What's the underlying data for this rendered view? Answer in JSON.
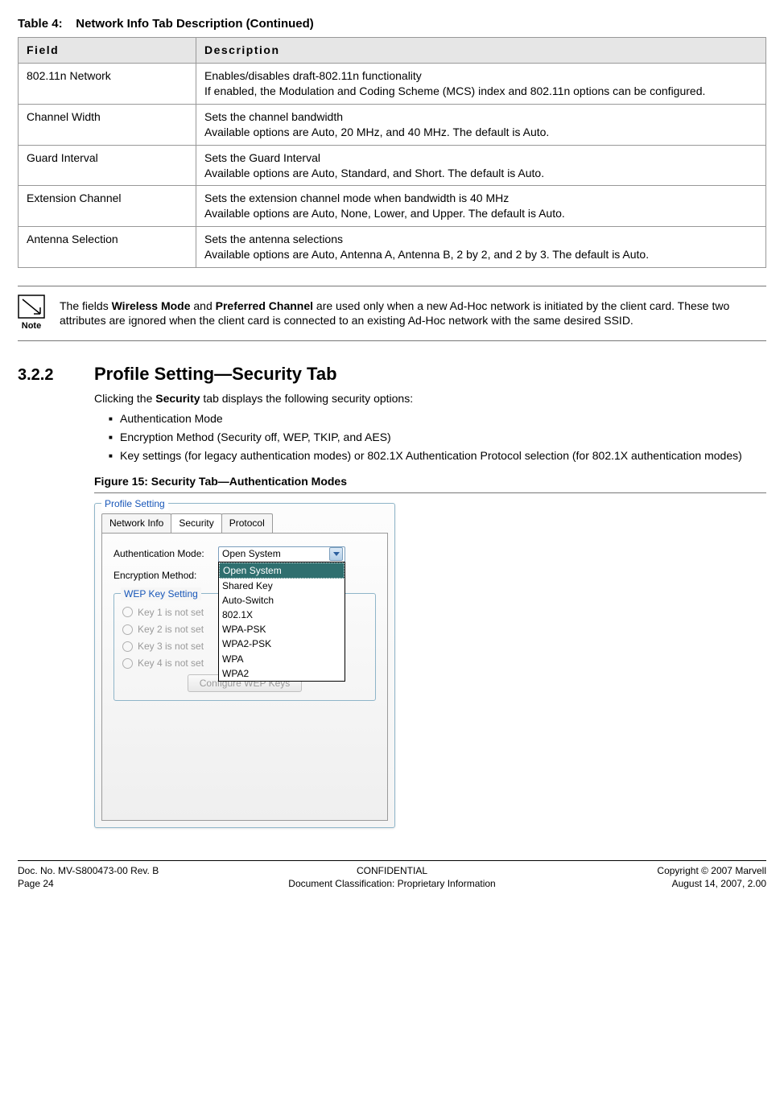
{
  "table": {
    "caption_label": "Table 4:",
    "caption_title": "Network Info Tab Description (Continued)",
    "header_field": "Field",
    "header_desc": "Description",
    "rows": [
      {
        "field": "802.11n Network",
        "desc": "Enables/disables draft-802.11n functionality\nIf enabled, the Modulation and Coding Scheme (MCS) index and 802.11n options can be configured."
      },
      {
        "field": "Channel Width",
        "desc": "Sets the channel bandwidth\nAvailable options are Auto, 20 MHz, and 40 MHz. The default is Auto."
      },
      {
        "field": "Guard Interval",
        "desc": "Sets the Guard Interval\nAvailable options are Auto, Standard, and Short. The default is Auto."
      },
      {
        "field": "Extension Channel",
        "desc": "Sets the extension channel mode when bandwidth is 40 MHz\nAvailable options are Auto, None, Lower, and Upper. The default is Auto."
      },
      {
        "field": "Antenna Selection",
        "desc": "Sets the antenna selections\nAvailable options are Auto, Antenna A, Antenna B, 2 by 2, and 2 by 3. The default is Auto."
      }
    ]
  },
  "note": {
    "label": "Note",
    "text_pre": "The fields ",
    "bold1": "Wireless Mode",
    "text_mid": " and ",
    "bold2": "Preferred Channel",
    "text_post": " are used only when a new Ad-Hoc network is initiated by the client card. These two attributes are ignored when the client card is connected to an existing Ad-Hoc network with the same desired SSID."
  },
  "section": {
    "number": "3.2.2",
    "title": "Profile Setting—Security Tab",
    "intro_pre": "Clicking the ",
    "intro_bold": "Security",
    "intro_post": " tab displays the following security options:",
    "bullets": [
      "Authentication Mode",
      "Encryption Method (Security off, WEP, TKIP, and AES)",
      "Key settings (for legacy authentication modes) or 802.1X Authentication Protocol selection (for 802.1X authentication modes)"
    ],
    "figure_caption": "Figure 15: Security Tab—Authentication Modes"
  },
  "dialog": {
    "fieldset_title": "Profile Setting",
    "tabs": {
      "network": "Network Info",
      "security": "Security",
      "protocol": "Protocol"
    },
    "auth_label": "Authentication Mode:",
    "enc_label": "Encryption Method:",
    "auth_value": "Open System",
    "auth_options": [
      "Open System",
      "Shared Key",
      "Auto-Switch",
      "802.1X",
      "WPA-PSK",
      "WPA2-PSK",
      "WPA",
      "WPA2"
    ],
    "wep_title": "WEP Key Setting",
    "wep_keys": [
      "Key 1 is not set",
      "Key 2 is not set",
      "Key 3 is not set",
      "Key 4 is not set"
    ],
    "configure_btn": "Configure WEP Keys"
  },
  "footer": {
    "doc_no": "Doc. No. MV-S800473-00 Rev. B",
    "page": "Page 24",
    "conf": "CONFIDENTIAL",
    "classification": "Document Classification: Proprietary Information",
    "copyright": "Copyright © 2007 Marvell",
    "date": "August 14, 2007, 2.00"
  }
}
